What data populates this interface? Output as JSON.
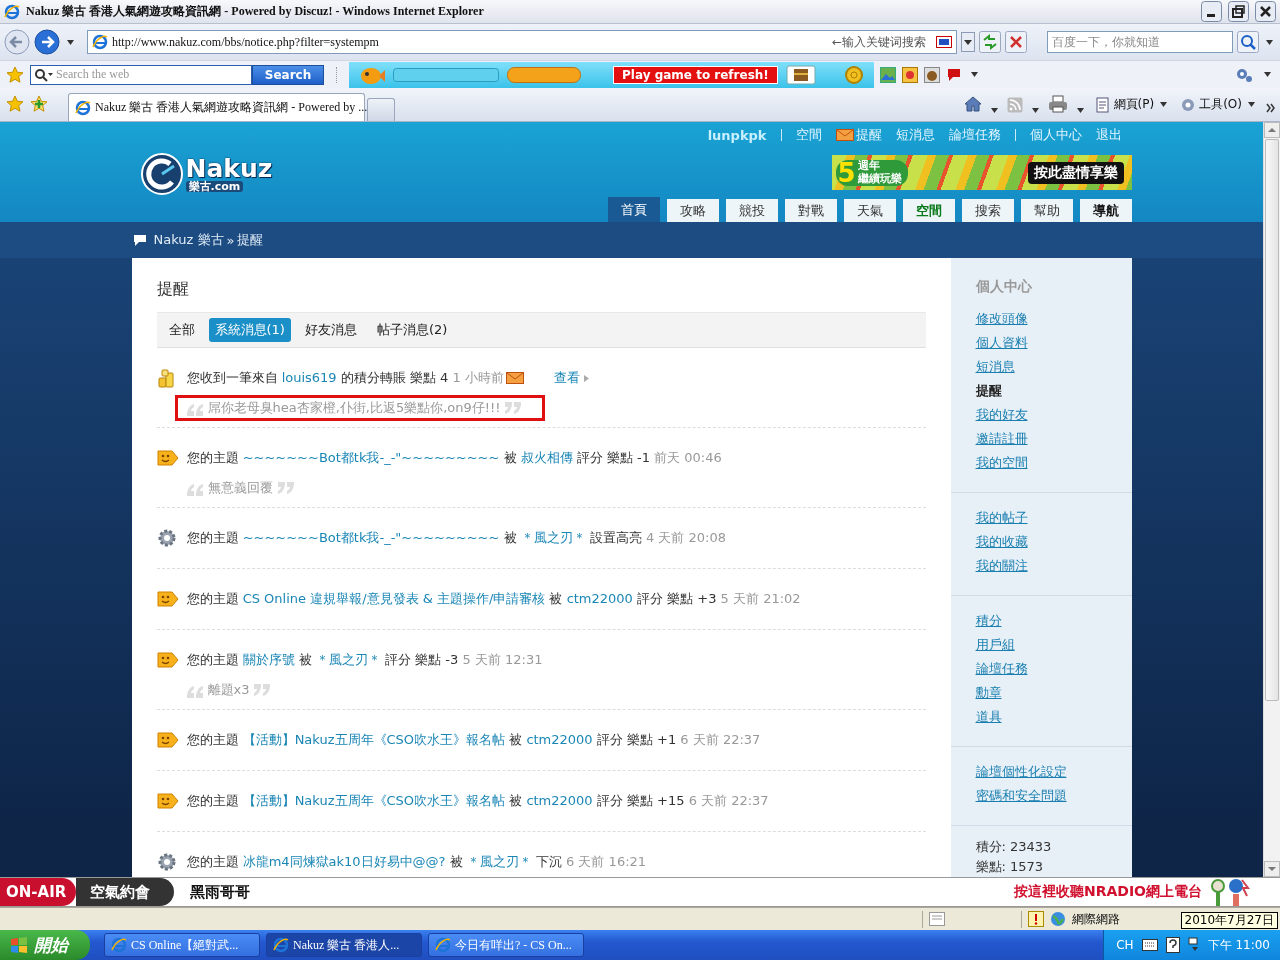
{
  "window": {
    "title": "Nakuz 樂古 香港人氣網遊攻略資訊網 - Powered by Discuz! - Windows Internet Explorer"
  },
  "address_bar": {
    "url": "http://www.nakuz.com/bbs/notice.php?filter=systempm",
    "hint": "←输入关键词搜索",
    "search_placeholder": "百度一下，你就知道"
  },
  "toolbar": {
    "search_placeholder": "Search the web",
    "search_button": "Search",
    "game_button": "Play game to refresh!"
  },
  "tabs": [
    {
      "label": "Nakuz 樂古 香港人氣網遊攻略資訊網 - Powered by ...",
      "selected": true
    }
  ],
  "command_bar": [
    "網頁(P)",
    "工具(O)"
  ],
  "site": {
    "logo": "Nakuz",
    "logo_sub": "樂古.com",
    "top_links": [
      {
        "label": "lunpkpk",
        "kind": "user",
        "divider_before": false
      },
      {
        "label": "空間",
        "kind": "link",
        "divider_before": true
      },
      {
        "label": "提醒",
        "kind": "mail",
        "divider_before": false
      },
      {
        "label": "短消息",
        "kind": "link",
        "divider_before": false
      },
      {
        "label": "論壇任務",
        "kind": "link",
        "divider_before": false
      },
      {
        "label": "個人中心",
        "kind": "link",
        "divider_before": true
      },
      {
        "label": "退出",
        "kind": "link",
        "divider_before": false
      }
    ],
    "banner": {
      "year": "5",
      "badge_top": "週年",
      "badge_bottom": "繼續玩樂",
      "cta": "按此盡情享樂"
    },
    "nav": [
      {
        "label": "首頁",
        "kind": "plain",
        "selected": true
      },
      {
        "label": "攻略",
        "kind": "plain",
        "selected": false
      },
      {
        "label": "競投",
        "kind": "plain",
        "selected": false
      },
      {
        "label": "對戰",
        "kind": "plain",
        "selected": false
      },
      {
        "label": "天氣",
        "kind": "plain",
        "selected": false
      },
      {
        "label": "空間",
        "kind": "green",
        "selected": false
      },
      {
        "label": "搜索",
        "kind": "plain",
        "selected": false
      },
      {
        "label": "幫助",
        "kind": "plain",
        "selected": false
      },
      {
        "label": "導航",
        "kind": "bold",
        "selected": false
      }
    ],
    "breadcrumb": {
      "items": [
        "Nakuz 樂古",
        "提醒"
      ],
      "separator": "»"
    }
  },
  "notices_page": {
    "title": "提醒",
    "filters": [
      {
        "label": "全部",
        "selected": false
      },
      {
        "label": "系統消息(1)",
        "selected": true
      },
      {
        "label": "好友消息",
        "selected": false
      },
      {
        "label": "帖子消息(2)",
        "selected": false
      }
    ],
    "notices": [
      {
        "kind": "coins",
        "parts": [
          {
            "text": "您收到一筆來自",
            "kind": "plain"
          },
          {
            "text": "louis619",
            "kind": "link"
          },
          {
            "text": "的積分轉賬 樂點 4",
            "kind": "plain"
          },
          {
            "text": "1 小時前",
            "kind": "time"
          }
        ],
        "mail": true,
        "action": "查看",
        "quote": "屌你老母臭hea杏家橙,仆街,比返5樂點你,on9仔!!!",
        "highlighted": true
      },
      {
        "kind": "smile",
        "parts": [
          {
            "text": "您的主題",
            "kind": "plain"
          },
          {
            "text": "~~~~~~~Bot都tk我-_-\"~~~~~~~~~",
            "kind": "link"
          },
          {
            "text": "被",
            "kind": "plain"
          },
          {
            "text": "叔火相傳",
            "kind": "link"
          },
          {
            "text": "評分 樂點 -1",
            "kind": "plain"
          },
          {
            "text": "前天 00:46",
            "kind": "time"
          }
        ],
        "mail": false,
        "quote": "無意義回覆",
        "highlighted": false
      },
      {
        "kind": "gear",
        "parts": [
          {
            "text": "您的主題",
            "kind": "plain"
          },
          {
            "text": "~~~~~~~Bot都tk我-_-\"~~~~~~~~~",
            "kind": "link"
          },
          {
            "text": "被",
            "kind": "plain"
          },
          {
            "text": "＊風之刃＊",
            "kind": "link"
          },
          {
            "text": "設置高亮",
            "kind": "plain"
          },
          {
            "text": "4 天前 20:08",
            "kind": "time"
          }
        ],
        "mail": false
      },
      {
        "kind": "smile",
        "parts": [
          {
            "text": "您的主題",
            "kind": "plain"
          },
          {
            "text": "CS Online 違規舉報/意見發表 & 主題操作/申請審核",
            "kind": "link"
          },
          {
            "text": "被",
            "kind": "plain"
          },
          {
            "text": "ctm22000",
            "kind": "link"
          },
          {
            "text": "評分 樂點 +3",
            "kind": "plain"
          },
          {
            "text": "5 天前 21:02",
            "kind": "time"
          }
        ],
        "mail": false
      },
      {
        "kind": "smile",
        "parts": [
          {
            "text": "您的主題",
            "kind": "plain"
          },
          {
            "text": "關於序號",
            "kind": "link"
          },
          {
            "text": "被",
            "kind": "plain"
          },
          {
            "text": "＊風之刃＊",
            "kind": "link"
          },
          {
            "text": "評分 樂點 -3",
            "kind": "plain"
          },
          {
            "text": "5 天前 12:31",
            "kind": "time"
          }
        ],
        "mail": false,
        "quote": "離題x3",
        "highlighted": false
      },
      {
        "kind": "smile",
        "parts": [
          {
            "text": "您的主題",
            "kind": "plain"
          },
          {
            "text": "【活動】Nakuz五周年《CSO吹水王》報名帖",
            "kind": "link"
          },
          {
            "text": "被",
            "kind": "plain"
          },
          {
            "text": "ctm22000",
            "kind": "link"
          },
          {
            "text": "評分 樂點 +1",
            "kind": "plain"
          },
          {
            "text": "6 天前 22:37",
            "kind": "time"
          }
        ],
        "mail": false
      },
      {
        "kind": "smile",
        "parts": [
          {
            "text": "您的主題",
            "kind": "plain"
          },
          {
            "text": "【活動】Nakuz五周年《CSO吹水王》報名帖",
            "kind": "link"
          },
          {
            "text": "被",
            "kind": "plain"
          },
          {
            "text": "ctm22000",
            "kind": "link"
          },
          {
            "text": "評分 樂點 +15",
            "kind": "plain"
          },
          {
            "text": "6 天前 22:37",
            "kind": "time"
          }
        ],
        "mail": false
      },
      {
        "kind": "gear",
        "parts": [
          {
            "text": "您的主題",
            "kind": "plain"
          },
          {
            "text": "冰龍m4同煉獄ak10日好易中@@?",
            "kind": "link"
          },
          {
            "text": "被",
            "kind": "plain"
          },
          {
            "text": "＊風之刃＊",
            "kind": "link"
          },
          {
            "text": "下沉",
            "kind": "plain"
          },
          {
            "text": "6 天前 16:21",
            "kind": "time"
          }
        ],
        "mail": false
      }
    ]
  },
  "sidebar": {
    "title": "個人中心",
    "groups": [
      [
        {
          "label": "修改頭像",
          "selected": false
        },
        {
          "label": "個人資料",
          "selected": false
        },
        {
          "label": "短消息",
          "selected": false
        },
        {
          "label": "提醒",
          "selected": true
        },
        {
          "label": "我的好友",
          "selected": false
        },
        {
          "label": "邀請註冊",
          "selected": false
        },
        {
          "label": "我的空間",
          "selected": false
        }
      ],
      [
        {
          "label": "我的帖子",
          "selected": false
        },
        {
          "label": "我的收藏",
          "selected": false
        },
        {
          "label": "我的關注",
          "selected": false
        }
      ],
      [
        {
          "label": "積分",
          "selected": false
        },
        {
          "label": "用戶組",
          "selected": false
        },
        {
          "label": "論壇任務",
          "selected": false
        },
        {
          "label": "勳章",
          "selected": false
        },
        {
          "label": "道具",
          "selected": false
        }
      ],
      [
        {
          "label": "論壇個性化設定",
          "selected": false
        },
        {
          "label": "密碼和安全問題",
          "selected": false
        }
      ]
    ],
    "stats": [
      "積分: 23433",
      "樂點: 1573"
    ]
  },
  "radio_bar": {
    "badge": "ON-AIR",
    "program": "空氣約會",
    "host": "黑雨哥哥",
    "link": "按這裡收聽NRADIO網上電台"
  },
  "status_bar": {
    "zone": "網際網路",
    "tooltip": "2010年7月27日"
  },
  "taskbar": {
    "start": "開始",
    "items": [
      {
        "label": "CS Online【絕對武...",
        "selected": false
      },
      {
        "label": "Nakuz 樂古 香港人...",
        "selected": true
      },
      {
        "label": "今日有咩出? - CS On...",
        "selected": false
      }
    ],
    "language": "CH",
    "clock": "下午 11:00"
  }
}
